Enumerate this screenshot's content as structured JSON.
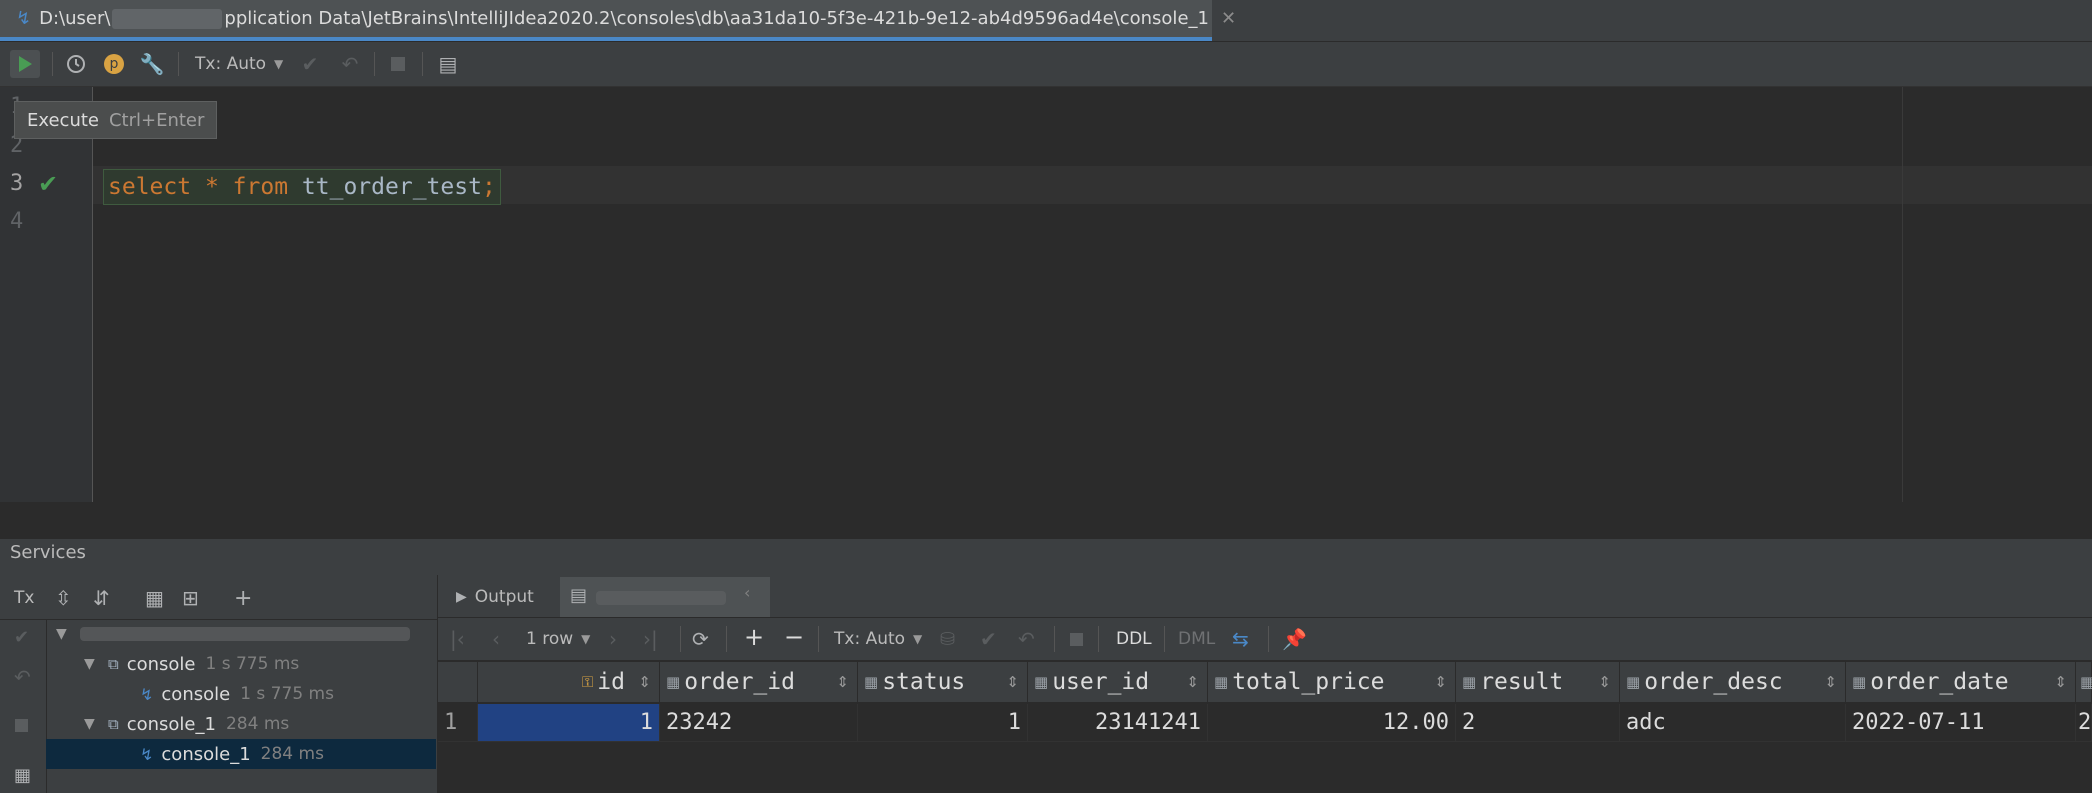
{
  "tab": {
    "path_prefix": "D:\\user\\",
    "path_suffix": "pplication Data\\JetBrains\\IntelliJIdea2020.2\\consoles\\db\\aa31da10-5f3e-421b-9e12-ab4d9596ad4e\\console_1",
    "close": "✕"
  },
  "toolbar": {
    "tx_label": "Tx: Auto",
    "p_label": "p"
  },
  "tooltip": {
    "label": "Execute",
    "shortcut": "Ctrl+Enter"
  },
  "editor": {
    "line_numbers": [
      "1",
      "2",
      "3",
      "4"
    ],
    "code": {
      "kw1": "select",
      "star": "*",
      "kw2": "from",
      "table": "tt_order_test",
      "semi": ";"
    }
  },
  "services": {
    "title": "Services",
    "tx_short": "Tx",
    "tree": [
      {
        "label": "console",
        "time": "1 s 775 ms"
      },
      {
        "label": "console",
        "time": "1 s 775 ms"
      },
      {
        "label": "console_1",
        "time": "284 ms"
      },
      {
        "label": "console_1",
        "time": "284 ms"
      }
    ]
  },
  "results": {
    "tabs": {
      "output": "Output"
    },
    "toolbar": {
      "rows": "1 row",
      "tx": "Tx: Auto",
      "ddl": "DDL",
      "dml": "DML"
    },
    "columns": [
      "id",
      "order_id",
      "status",
      "user_id",
      "total_price",
      "result",
      "order_desc",
      "order_date"
    ],
    "rows": [
      {
        "num": "1",
        "id": "1",
        "order_id": "23242",
        "status": "1",
        "user_id": "23141241",
        "total_price": "12.00",
        "result": "2",
        "order_desc": "adc",
        "order_date": "2022-07-11",
        "next": "2"
      }
    ]
  },
  "colors": {
    "accent": "#4a88c7",
    "keyword": "#cc7832",
    "run": "#499c54",
    "selection": "#214283"
  }
}
